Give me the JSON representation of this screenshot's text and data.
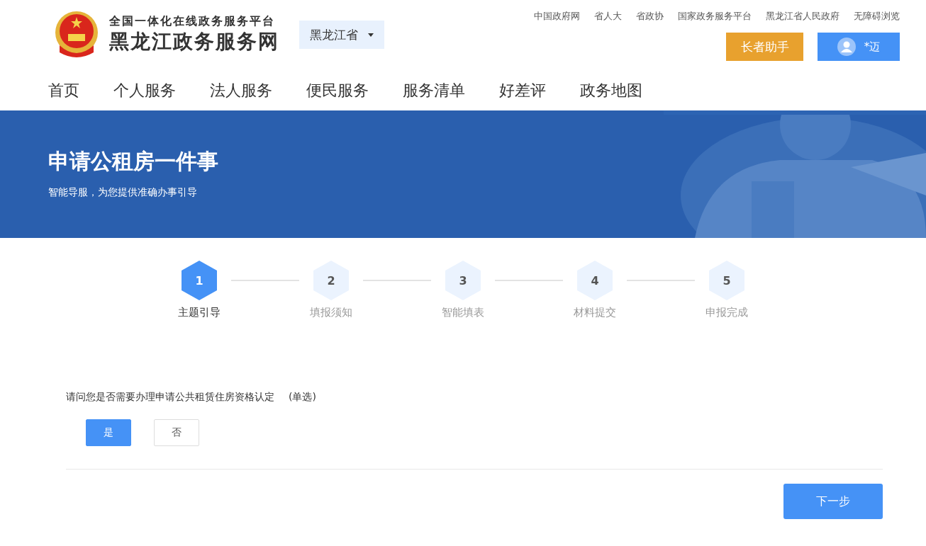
{
  "header": {
    "subtitle": "全国一体化在线政务服务平台",
    "title": "黑龙江政务服务网",
    "region": "黑龙江省",
    "links": [
      "中国政府网",
      "省人大",
      "省政协",
      "国家政务服务平台",
      "黑龙江省人民政府",
      "无障碍浏览"
    ],
    "elder_button": "长者助手",
    "user": "*迈"
  },
  "nav": [
    {
      "label": "首页"
    },
    {
      "label": "个人服务"
    },
    {
      "label": "法人服务"
    },
    {
      "label": "便民服务"
    },
    {
      "label": "服务清单"
    },
    {
      "label": "好差评"
    },
    {
      "label": "政务地图"
    }
  ],
  "banner": {
    "title": "申请公租房一件事",
    "subtitle": "智能导服，为您提供准确办事引导"
  },
  "steps": [
    {
      "number": "1",
      "label": "主题引导",
      "selected": true
    },
    {
      "number": "2",
      "label": "填报须知",
      "selected": false
    },
    {
      "number": "3",
      "label": "智能填表",
      "selected": false
    },
    {
      "number": "4",
      "label": "材料提交",
      "selected": false
    },
    {
      "number": "5",
      "label": "申报完成",
      "selected": false
    }
  ],
  "question": {
    "text": "请问您是否需要办理申请公共租赁住房资格认定",
    "note": "(单选)",
    "options": [
      {
        "label": "是",
        "selected": true
      },
      {
        "label": "否",
        "selected": false
      }
    ]
  },
  "next_button": "下一步"
}
